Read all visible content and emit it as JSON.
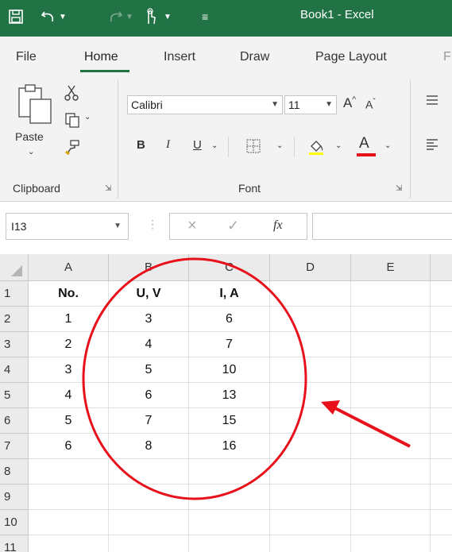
{
  "window": {
    "title": "Book1  -  Excel"
  },
  "tabs": [
    {
      "label": "File",
      "active": false
    },
    {
      "label": "Home",
      "active": true
    },
    {
      "label": "Insert",
      "active": false
    },
    {
      "label": "Draw",
      "active": false
    },
    {
      "label": "Page Layout",
      "active": false
    },
    {
      "label": "F",
      "active": false
    }
  ],
  "ribbon": {
    "clipboard": {
      "paste_label": "Paste",
      "group_label": "Clipboard"
    },
    "font": {
      "font_name": "Calibri",
      "font_size": "11",
      "group_label": "Font",
      "bold": "B",
      "italic": "I",
      "underline": "U",
      "font_color_letter": "A",
      "grow_letter": "A",
      "shrink_letter": "A"
    }
  },
  "formula_bar": {
    "name_box": "I13",
    "fx_label": "fx",
    "value": ""
  },
  "sheet": {
    "columns": [
      "A",
      "B",
      "C",
      "D",
      "E"
    ],
    "rows": [
      "1",
      "2",
      "3",
      "4",
      "5",
      "6",
      "7",
      "8",
      "9",
      "10",
      "11"
    ],
    "cells": [
      [
        "No.",
        "U, V",
        "I, A",
        "",
        ""
      ],
      [
        "1",
        "3",
        "6",
        "",
        ""
      ],
      [
        "2",
        "4",
        "7",
        "",
        ""
      ],
      [
        "3",
        "5",
        "10",
        "",
        ""
      ],
      [
        "4",
        "6",
        "13",
        "",
        ""
      ],
      [
        "5",
        "7",
        "15",
        "",
        ""
      ],
      [
        "6",
        "8",
        "16",
        "",
        ""
      ],
      [
        "",
        "",
        "",
        "",
        ""
      ],
      [
        "",
        "",
        "",
        "",
        ""
      ],
      [
        "",
        "",
        "",
        "",
        ""
      ],
      [
        "",
        "",
        "",
        "",
        ""
      ]
    ]
  },
  "colors": {
    "excel_green": "#217346",
    "annotation_red": "#e8111b",
    "font_color_bar": "#e8111b"
  }
}
